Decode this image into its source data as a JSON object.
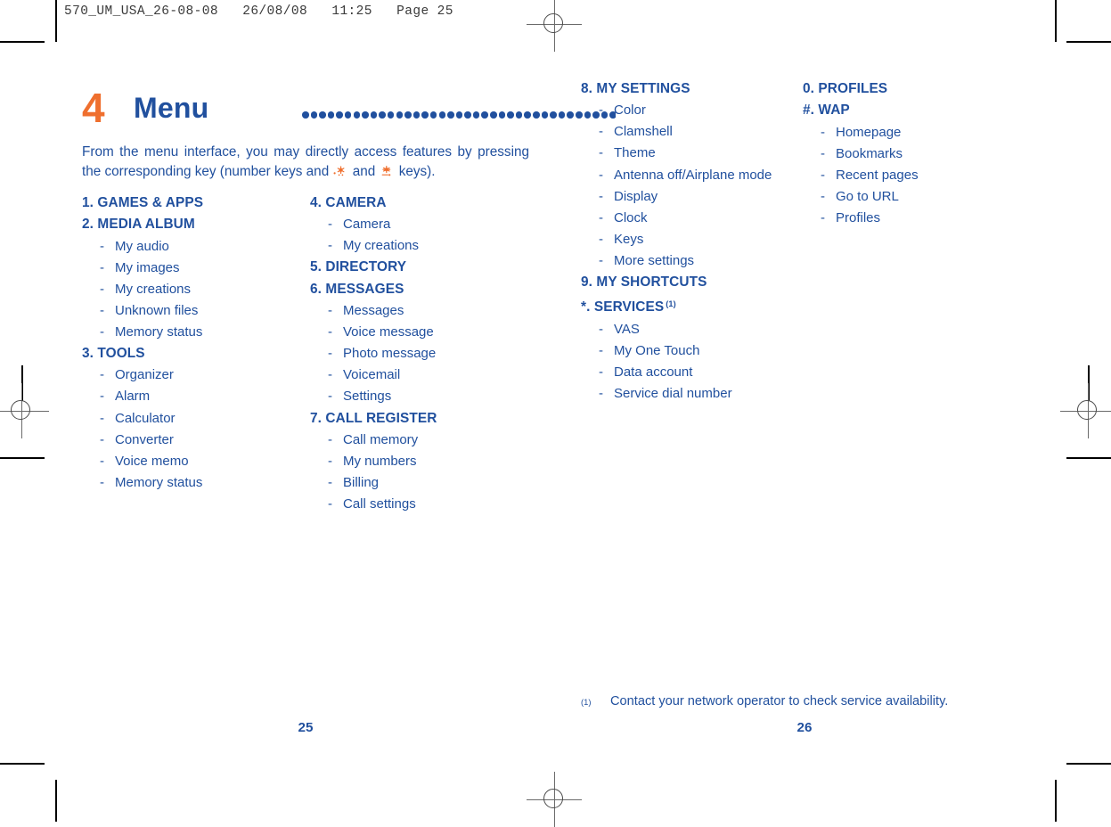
{
  "prepress": {
    "slug": "570_UM_USA_26-08-08   26/08/08   11:25   Page 25"
  },
  "colors": {
    "navy": "#21509e",
    "orange": "#ef6f2e"
  },
  "chapter": {
    "number": "4",
    "title": "Menu",
    "leader_dot_count": 37
  },
  "intro": {
    "part1": "From the menu interface, you may directly access features by pressing the corresponding key (number keys and",
    "part2": "and",
    "part3": "keys)."
  },
  "columns": [
    {
      "id": "column-1",
      "groups": [
        {
          "heading": "1. GAMES & APPS",
          "items": []
        },
        {
          "heading": "2. MEDIA ALBUM",
          "items": [
            "My audio",
            "My images",
            "My creations",
            "Unknown files",
            "Memory status"
          ]
        },
        {
          "heading": "3. TOOLS",
          "items": [
            "Organizer",
            "Alarm",
            "Calculator",
            "Converter",
            "Voice memo",
            "Memory status"
          ]
        }
      ]
    },
    {
      "id": "column-2",
      "groups": [
        {
          "heading": "4. CAMERA",
          "items": [
            "Camera",
            "My creations"
          ]
        },
        {
          "heading": "5. DIRECTORY",
          "items": []
        },
        {
          "heading": "6. MESSAGES",
          "items": [
            "Messages",
            "Voice message",
            "Photo message",
            "Voicemail",
            "Settings"
          ]
        },
        {
          "heading": "7. CALL REGISTER",
          "items": [
            "Call memory",
            "My numbers",
            "Billing",
            "Call settings"
          ]
        }
      ]
    },
    {
      "id": "column-3",
      "groups": [
        {
          "heading": "8. MY SETTINGS",
          "items": [
            "Color",
            "Clamshell",
            "Theme",
            "Antenna off/Airplane mode",
            "Display",
            "Clock",
            "Keys",
            "More settings"
          ]
        },
        {
          "heading": "9. MY SHORTCUTS",
          "items": []
        },
        {
          "heading": "*. SERVICES",
          "footnote_mark": "(1)",
          "items": [
            "VAS",
            "My One Touch",
            "Data account",
            "Service dial number"
          ]
        }
      ]
    },
    {
      "id": "column-4",
      "groups": [
        {
          "heading": "0. PROFILES",
          "items": []
        },
        {
          "heading": "#. WAP",
          "items": [
            "Homepage",
            "Bookmarks",
            "Recent pages",
            "Go to URL",
            "Profiles"
          ]
        }
      ]
    }
  ],
  "footnote": {
    "mark": "(1)",
    "text": "Contact your network operator to check service availability."
  },
  "folios": {
    "left": "25",
    "right": "26"
  },
  "dash_bullet": "-"
}
